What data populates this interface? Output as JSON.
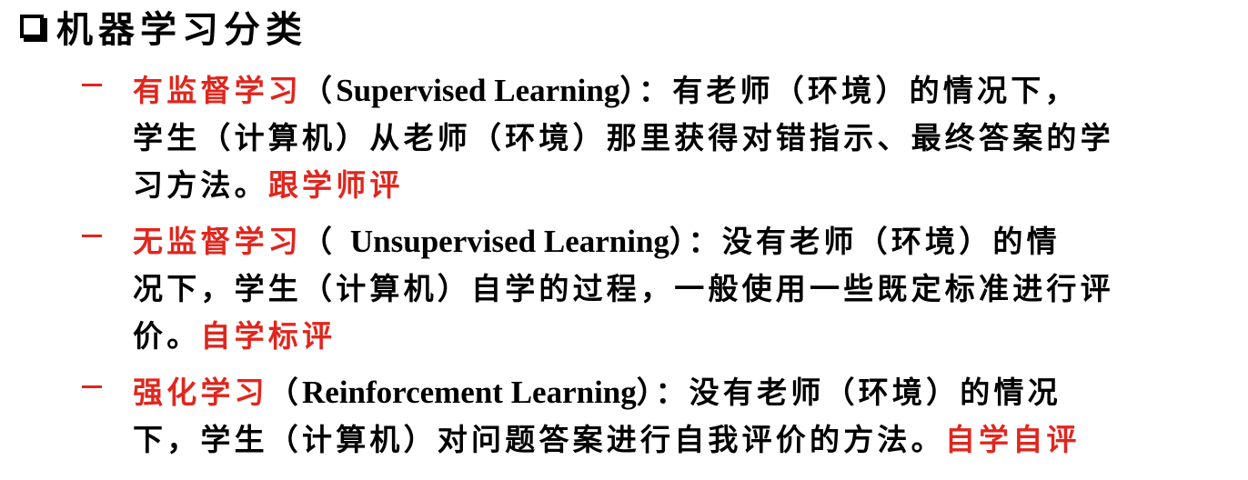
{
  "heading": {
    "icon": "checkbox-square-icon",
    "text": "机器学习分类"
  },
  "items": [
    {
      "bullet": "–",
      "term": "有监督学习",
      "open_paren": "（",
      "english": "Supervised Learning",
      "line1_rest": "）：有老师（环境）的情况下，",
      "line2": "学生（计算机）从老师（环境）那里获得对错指示、最终答案的学",
      "line3_text": "习方法。",
      "tag": "跟学师评"
    },
    {
      "bullet": "–",
      "term": "无监督学习",
      "open_paren": "（ ",
      "english": "Unsupervised Learning",
      "line1_rest": "）：没有老师（环境）的情",
      "line2": "况下，学生（计算机）自学的过程，一般使用一些既定标准进行评",
      "line3_text": "价。",
      "tag": "自学标评"
    },
    {
      "bullet": "–",
      "term": "强化学习",
      "open_paren": "（",
      "english": "Reinforcement Learning",
      "line1_rest": "）：没有老师（环境）的情况",
      "line2_text": "下，学生（计算机）对问题答案进行自我评价的方法。",
      "tag": "自学自评"
    }
  ],
  "colors": {
    "accent_red": "#e0261d",
    "text": "#000000",
    "background": "#ffffff"
  }
}
